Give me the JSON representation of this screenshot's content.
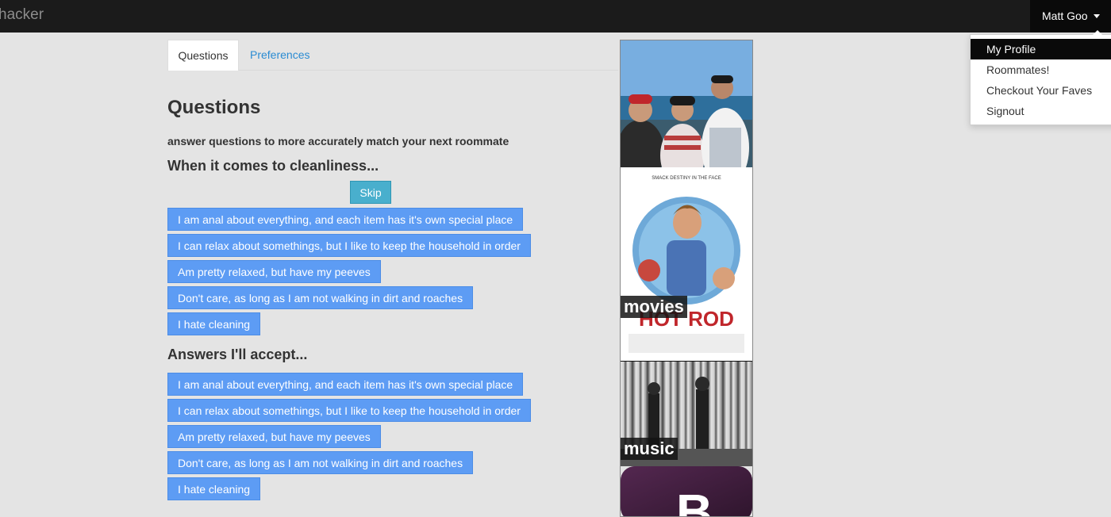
{
  "navbar": {
    "brand": "hacker",
    "user_name": "Matt Goo",
    "menu": [
      {
        "label": "My Profile",
        "active": true
      },
      {
        "label": "Roommates!",
        "active": false
      },
      {
        "label": "Checkout Your Faves",
        "active": false
      },
      {
        "label": "Signout",
        "active": false
      }
    ]
  },
  "tabs": [
    {
      "label": "Questions",
      "active": true
    },
    {
      "label": "Preferences",
      "active": false
    }
  ],
  "main": {
    "title": "Questions",
    "subtitle": "answer questions to more accurately match your next roommate",
    "question": "When it comes to cleanliness...",
    "skip_label": "Skip",
    "options": [
      "I am anal about everything, and each item has it's own special place",
      "I can relax about somethings, but I like to keep the household in order",
      "Am pretty relaxed, but have my peeves",
      "Don't care, as long as I am not walking in dirt and roaches",
      "I hate cleaning"
    ],
    "accept_heading": "Answers I'll accept...",
    "accept_options": [
      "I am anal about everything, and each item has it's own special place",
      "I can relax about somethings, but I like to keep the household in order",
      "Am pretty relaxed, but have my peeves",
      "Don't care, as long as I am not walking in dirt and roaches",
      "I hate cleaning"
    ]
  },
  "sidebar": {
    "poster_tagline": "SMACK DESTINY IN THE FACE",
    "poster_title": "HOT ROD",
    "app_letter": "B",
    "categories": [
      {
        "label": "movies"
      },
      {
        "label": "music"
      }
    ]
  },
  "colors": {
    "navbar": "#1b1b1b",
    "option_button": "#5d9cf4",
    "skip_button": "#49afcd",
    "link": "#2a8bd2"
  }
}
